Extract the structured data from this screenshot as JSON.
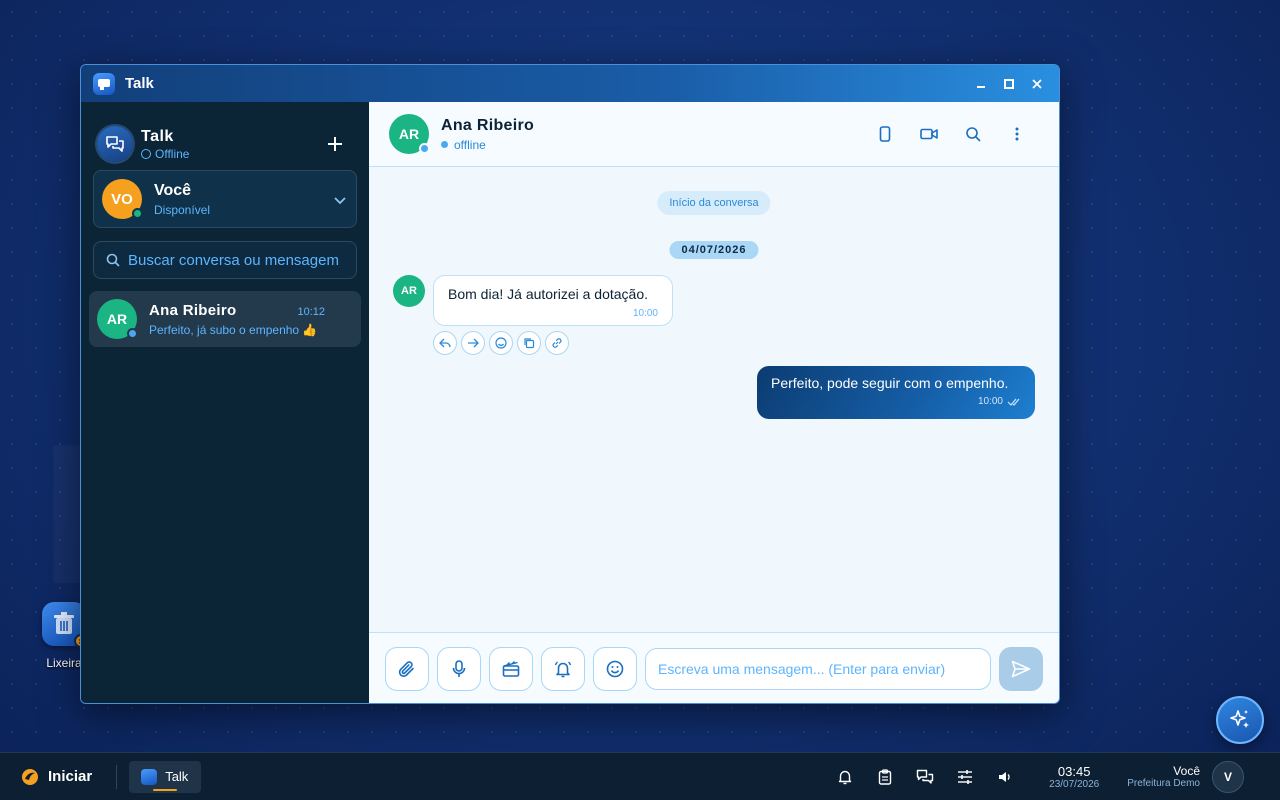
{
  "window": {
    "title": "Talk"
  },
  "sidebar": {
    "app_name": "Talk",
    "app_status": "Offline",
    "me": {
      "initials": "VO",
      "name": "Você",
      "status": "Disponível",
      "status_color": "#1bb584"
    },
    "search_placeholder": "Buscar conversa ou mensagem",
    "conversations": [
      {
        "initials": "AR",
        "name": "Ana Ribeiro",
        "time": "10:12",
        "preview": "Perfeito, já subo o empenho 👍"
      }
    ]
  },
  "chat": {
    "contact": {
      "initials": "AR",
      "name": "Ana Ribeiro",
      "status": "offline"
    },
    "start_label": "Início da conversa",
    "date_label": "04/07/2026",
    "messages": [
      {
        "direction": "in",
        "initials": "AR",
        "text": "Bom dia! Já autorizei a dotação.",
        "time": "10:00"
      },
      {
        "direction": "out",
        "text": "Perfeito, pode seguir com o empenho.",
        "time": "10:00"
      }
    ],
    "composer_placeholder": "Escreva uma mensagem... (Enter para enviar)"
  },
  "desktop": {
    "trash_label": "Lixeira"
  },
  "taskbar": {
    "start_label": "Iniciar",
    "app_label": "Talk",
    "time": "03:45",
    "date": "23/07/2026",
    "user_name": "Você",
    "user_org": "Prefeitura Demo",
    "user_initial": "V"
  },
  "colors": {
    "accent": "#5cb5ff",
    "online": "#1bb584",
    "me_avatar": "#f5a01e",
    "contact_avatar": "#1bb584"
  }
}
